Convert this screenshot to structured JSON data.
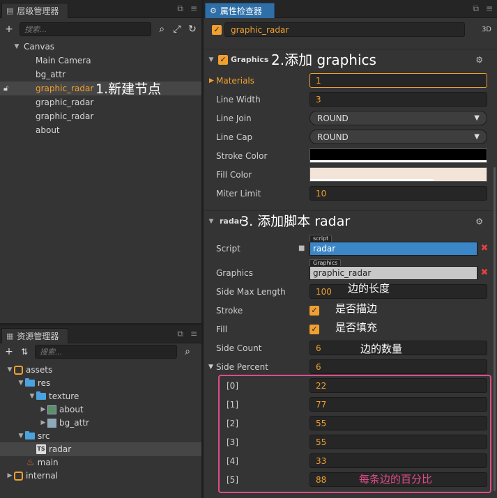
{
  "hierarchy": {
    "tab": "层级管理器",
    "search_placeholder": "搜索...",
    "nodes": [
      {
        "label": "Canvas"
      },
      {
        "label": "Main Camera"
      },
      {
        "label": "bg_attr"
      },
      {
        "label": "graphic_radar"
      },
      {
        "label": "graphic_radar"
      },
      {
        "label": "graphic_radar"
      },
      {
        "label": "about"
      }
    ]
  },
  "assets": {
    "tab": "资源管理器",
    "search_placeholder": "搜索...",
    "nodes": [
      {
        "label": "assets"
      },
      {
        "label": "res"
      },
      {
        "label": "texture"
      },
      {
        "label": "about"
      },
      {
        "label": "bg_attr"
      },
      {
        "label": "src"
      },
      {
        "label": "radar"
      },
      {
        "label": "main"
      },
      {
        "label": "internal"
      }
    ]
  },
  "inspector": {
    "tab": "属性检查器",
    "node_name": "graphic_radar",
    "mode_3d": "3D",
    "graphics_section": "Graphics",
    "radar_section": "radar",
    "props": {
      "materials_label": "Materials",
      "materials_value": "1",
      "line_width_label": "Line Width",
      "line_width_value": "3",
      "line_join_label": "Line Join",
      "line_join_value": "ROUND",
      "line_cap_label": "Line Cap",
      "line_cap_value": "ROUND",
      "stroke_color_label": "Stroke Color",
      "fill_color_label": "Fill Color",
      "miter_limit_label": "Miter Limit",
      "miter_limit_value": "10",
      "script_label": "Script",
      "script_tag": "script",
      "script_value": "radar",
      "graphics_label": "Graphics",
      "graphics_tag": "Graphics",
      "graphics_value": "graphic_radar",
      "side_max_label": "Side Max Length",
      "side_max_value": "100",
      "stroke_label": "Stroke",
      "fill_label": "Fill",
      "side_count_label": "Side Count",
      "side_count_value": "6",
      "side_percent_label": "Side Percent",
      "side_percent_value": "6"
    },
    "percent_items": [
      {
        "label": "[0]",
        "value": "22"
      },
      {
        "label": "[1]",
        "value": "77"
      },
      {
        "label": "[2]",
        "value": "55"
      },
      {
        "label": "[3]",
        "value": "55"
      },
      {
        "label": "[4]",
        "value": "33"
      },
      {
        "label": "[5]",
        "value": "88"
      }
    ],
    "colors": {
      "stroke": "#000000",
      "fill": "#f2e4d8"
    }
  },
  "annotations": {
    "a1": "1.新建节点",
    "a2": "2.添加 graphics",
    "a3": "3. 添加脚本 radar",
    "a4": "边的长度",
    "a5": "是否描边",
    "a6": "是否填充",
    "a7": "边的数量",
    "a8": "每条边的百分比"
  }
}
